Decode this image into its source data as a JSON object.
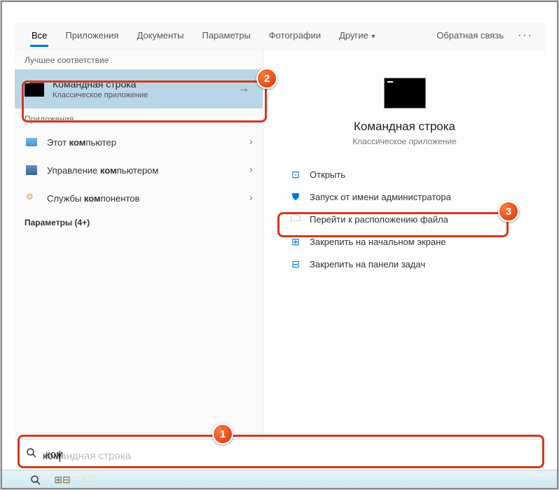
{
  "tabs": {
    "all": "Все",
    "apps": "Приложения",
    "docs": "Документы",
    "settings": "Параметры",
    "photos": "Фотографии",
    "other": "Другие"
  },
  "header": {
    "feedback": "Обратная связь",
    "more": "···"
  },
  "sections": {
    "bestMatch": "Лучшее соответствие",
    "apps": "Приложения",
    "settings": "Параметры (4+)"
  },
  "bestMatch": {
    "title": "Командная строка",
    "subtitle": "Классическое приложение"
  },
  "appResults": [
    {
      "label_pre": "Этот ",
      "label_bold": "ком",
      "label_post": "пьютер"
    },
    {
      "label_pre": "Управление ",
      "label_bold": "ком",
      "label_post": "пьютером"
    },
    {
      "label_pre": "Службы ",
      "label_bold": "ком",
      "label_post": "понентов"
    }
  ],
  "detail": {
    "title": "Командная строка",
    "subtitle": "Классическое приложение"
  },
  "actions": {
    "open": "Открыть",
    "runAdmin": "Запуск от имени администратора",
    "openLocation": "Перейти к расположению файла",
    "pinStart": "Закрепить на начальном экране",
    "pinTaskbar": "Закрепить на панели задач"
  },
  "search": {
    "typed": "ком",
    "suggest": "андная строка"
  },
  "annotations": {
    "n1": "1",
    "n2": "2",
    "n3": "3"
  }
}
